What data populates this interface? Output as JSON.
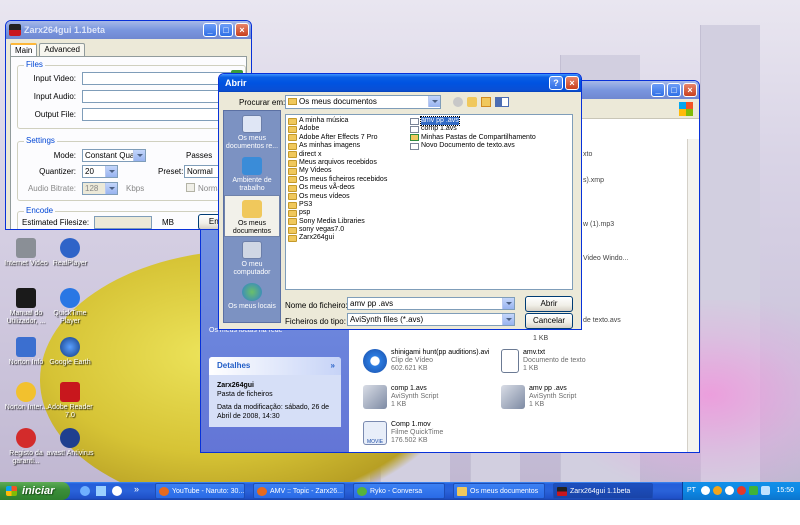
{
  "zarx": {
    "title": "Zarx264gui 1.1beta",
    "tabs": [
      "Main",
      "Advanced"
    ],
    "files_group": "Files",
    "input_video": "Input Video:",
    "input_audio": "Input Audio:",
    "output_file": "Output File:",
    "settings_group": "Settings",
    "mode_label": "Mode:",
    "mode_value": "Constant Quality",
    "passes_label": "Passes",
    "quantizer_label": "Quantizer:",
    "quantizer_value": "20",
    "preset_label": "Preset:",
    "preset_value": "Normal",
    "audio_bitrate_label": "Audio Bitrate:",
    "audio_bitrate_value": "128",
    "kbps": "Kbps",
    "normalize": "Normaliz",
    "encode_group": "Encode",
    "estimated_filesize": "Estimated Filesize:",
    "mb": "MB",
    "encode_button": "Enco"
  },
  "dialog": {
    "title": "Abrir",
    "look_in_label": "Procurar em:",
    "look_in_value": "Os meus documentos",
    "places": [
      {
        "label": "Os meus documentos re..."
      },
      {
        "label": "Ambiente de trabalho"
      },
      {
        "label": "Os meus documentos"
      },
      {
        "label": "O meu computador"
      },
      {
        "label": "Os meus locais"
      }
    ],
    "files_col1": [
      {
        "name": "A minha música",
        "type": "folder"
      },
      {
        "name": "Adobe",
        "type": "folder"
      },
      {
        "name": "Adobe After Effects 7 Pro",
        "type": "folder"
      },
      {
        "name": "As minhas imagens",
        "type": "folder"
      },
      {
        "name": "direct x",
        "type": "folder"
      },
      {
        "name": "Meus arquivos recebidos",
        "type": "folder"
      },
      {
        "name": "My Videos",
        "type": "folder"
      },
      {
        "name": "Os meus ficheiros recebidos",
        "type": "folder"
      },
      {
        "name": "Os meus vÃ-deos",
        "type": "folder"
      },
      {
        "name": "Os meus vídeos",
        "type": "folder"
      },
      {
        "name": "PS3",
        "type": "folder"
      },
      {
        "name": "psp",
        "type": "folder"
      },
      {
        "name": "Sony Media Libraries",
        "type": "folder"
      },
      {
        "name": "sony vegas7.0",
        "type": "folder"
      },
      {
        "name": "Zarx264gui",
        "type": "folder"
      }
    ],
    "files_col2": [
      {
        "name": "amv pp .avs",
        "type": "avs",
        "selected": true
      },
      {
        "name": "comp 1.avs",
        "type": "avs"
      },
      {
        "name": "Minhas Pastas de Compartilhamento",
        "type": "share"
      },
      {
        "name": "Novo Documento de texto.avs",
        "type": "avs"
      }
    ],
    "filename_label": "Nome do ficheiro:",
    "filename_value": "amv pp .avs",
    "filetype_label": "Ficheiros do tipo:",
    "filetype_value": "AviSynth files (*.avs)",
    "open_button": "Abrir",
    "cancel_button": "Cancelar"
  },
  "explorer": {
    "partial_labels": [
      "xto",
      "s).xmp",
      "w (1).mp3",
      "Video Windo...",
      "de texto.avs",
      "1 KB"
    ],
    "places_link": "Os meus locais na rede",
    "details_title": "Detalhes",
    "details_name": "Zarx264gui",
    "details_type": "Pasta de ficheiros",
    "details_modified": "Data da modificação: sábado, 26 de Abril de 2008, 14:30",
    "items": [
      {
        "name": "shinigami hunt(pp auditions).avi",
        "type": "Clip de Vídeo",
        "size": "602.621 KB"
      },
      {
        "name": "amv.txt",
        "type": "Documento de texto",
        "size": "1 KB"
      },
      {
        "name": "comp 1.avs",
        "type": "AviSynth Script",
        "size": "1 KB"
      },
      {
        "name": "amv pp .avs",
        "type": "AviSynth Script",
        "size": "1 KB"
      },
      {
        "name": "Comp 1.mov",
        "type": "Filme QuickTime",
        "size": "176.502 KB"
      }
    ],
    "mov_badge": "MOVIE"
  },
  "desktop_icons": [
    {
      "label": "Internet Video"
    },
    {
      "label": "RealPlayer"
    },
    {
      "label": "Manual do Utilizador, ..."
    },
    {
      "label": "QuickTime Player"
    },
    {
      "label": "Norton Info"
    },
    {
      "label": "Google Earth"
    },
    {
      "label": "Norton Inter..."
    },
    {
      "label": "Adobe Reader 7.0"
    },
    {
      "label": "Registo da garanti..."
    },
    {
      "label": "avast! Antivirus"
    }
  ],
  "taskbar": {
    "start": "iniciar",
    "tasks": [
      {
        "label": "YouTube - Naruto: 30..."
      },
      {
        "label": "AMV :: Topic - Zarx26..."
      },
      {
        "label": "Ryko - Conversa"
      },
      {
        "label": "Os meus documentos"
      },
      {
        "label": "Zarx264gui 1.1beta"
      }
    ],
    "lang": "PT",
    "clock": "15:50"
  },
  "colors": {
    "xp_blue": "#0a5ee4",
    "selection": "#316ac5",
    "folder": "#f0c85c"
  }
}
